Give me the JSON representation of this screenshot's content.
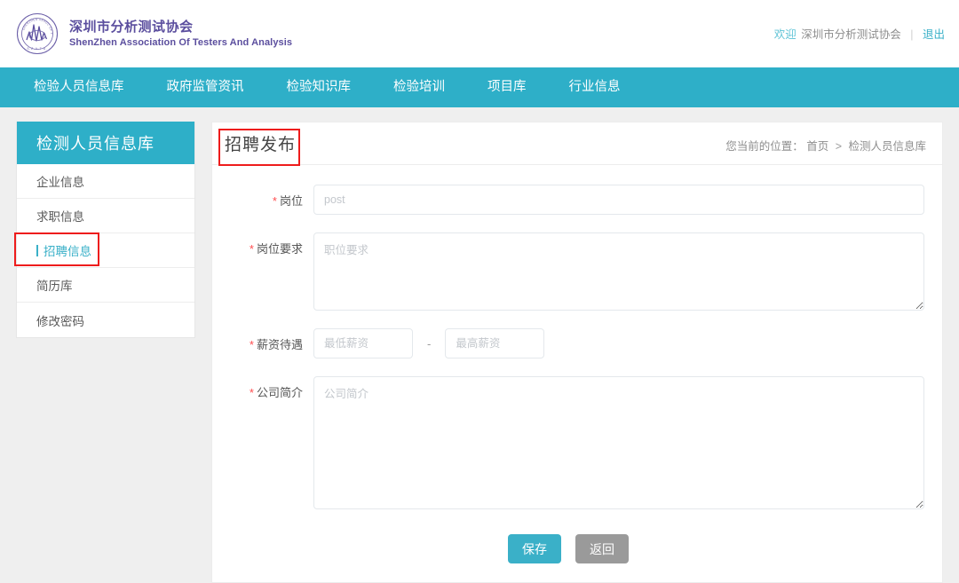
{
  "header": {
    "logo_icon": "association-seal-logo",
    "org_name_cn": "深圳市分析测试协会",
    "org_name_en": "ShenZhen Association Of Testers And Analysis",
    "welcome_label": "欢迎",
    "user_name": "深圳市分析测试协会",
    "separator": "|",
    "logout_label": "退出"
  },
  "nav": {
    "items": [
      {
        "label": "检验人员信息库"
      },
      {
        "label": "政府监管资讯"
      },
      {
        "label": "检验知识库"
      },
      {
        "label": "检验培训"
      },
      {
        "label": "项目库"
      },
      {
        "label": "行业信息"
      }
    ]
  },
  "sidebar": {
    "title": "检测人员信息库",
    "items": [
      {
        "label": "企业信息",
        "active": false
      },
      {
        "label": "求职信息",
        "active": false
      },
      {
        "label": "招聘信息",
        "active": true
      },
      {
        "label": "简历库",
        "active": false
      },
      {
        "label": "修改密码",
        "active": false
      }
    ]
  },
  "content": {
    "title": "招聘发布",
    "breadcrumb": {
      "label": "您当前的位置：",
      "home": "首页",
      "separator": ">",
      "current": "检测人员信息库"
    }
  },
  "form": {
    "post": {
      "label": "岗位",
      "required_mark": "*",
      "placeholder": "post",
      "value": ""
    },
    "requirement": {
      "label": "岗位要求",
      "required_mark": "*",
      "placeholder": "职位要求",
      "value": ""
    },
    "salary": {
      "label": "薪资待遇",
      "required_mark": "*",
      "min_placeholder": "最低薪资",
      "max_placeholder": "最高薪资",
      "dash": "-",
      "min_value": "",
      "max_value": ""
    },
    "company": {
      "label": "公司简介",
      "required_mark": "*",
      "placeholder": "公司简介",
      "value": ""
    },
    "actions": {
      "save_label": "保存",
      "back_label": "返回"
    }
  },
  "annotations": {
    "sidebar_highlight": "红色标注框-招聘信息",
    "title_highlight": "红色标注框-招聘发布"
  },
  "colors": {
    "accent_teal": "#2EAFC8",
    "button_teal": "#3AB0C8",
    "button_gray": "#9A9A9A",
    "brand_purple": "#5B4E9E",
    "annotation_red": "#EE1C1C",
    "page_bg": "#EFEFEF"
  }
}
